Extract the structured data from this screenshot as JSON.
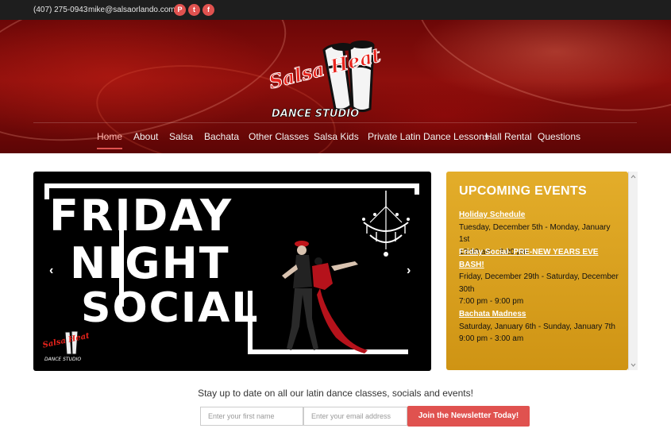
{
  "topbar": {
    "phone": "(407) 275-0943",
    "email": "mike@salsaorlando.com",
    "social": [
      {
        "icon": "pinterest-icon",
        "glyph": "P"
      },
      {
        "icon": "twitter-icon",
        "glyph": "t"
      },
      {
        "icon": "facebook-icon",
        "glyph": "f"
      }
    ]
  },
  "logo": {
    "script_text": "Salsa Heat",
    "subtitle": "DANCE STUDIO"
  },
  "nav": {
    "items": [
      "Home",
      "About",
      "Salsa",
      "Bachata",
      "Other Classes",
      "Salsa Kids",
      "Private Latin Dance Lessons",
      "Hall Rental",
      "Questions"
    ],
    "active": "Home"
  },
  "slider": {
    "line1": "FRIDAY",
    "line2": "NIGHT",
    "line3": "SOCIAL",
    "prev_glyph": "‹",
    "next_glyph": "›",
    "logo_text": "Salsa Heat",
    "logo_subtitle": "DANCE STUDIO"
  },
  "events": {
    "title": "UPCOMING EVENTS",
    "items": [
      {
        "name": "Holiday Schedule",
        "dates": "Tuesday, December 5th - Monday, January 1st",
        "time": "12:00 am - 3:00 pm"
      },
      {
        "name": "Friday Social- PRE-NEW YEARS EVE BASH!",
        "dates": "Friday, December 29th - Saturday, December 30th",
        "time": "7:00 pm - 9:00 pm"
      },
      {
        "name": "Bachata Madness",
        "dates": "Saturday, January 6th - Sunday, January 7th",
        "time": "9:00 pm - 3:00 am"
      }
    ]
  },
  "newsletter": {
    "text": "Stay up to date on all our latin dance classes, socials and events!",
    "first_name_placeholder": "Enter your first name",
    "email_placeholder": "Enter your email address",
    "button": "Join the Newsletter Today!"
  },
  "colors": {
    "accent": "#e0524f",
    "events_bg": "#d9a21f",
    "hero_red": "#8e0f0c",
    "topbar_bg": "#1e1e1e"
  }
}
